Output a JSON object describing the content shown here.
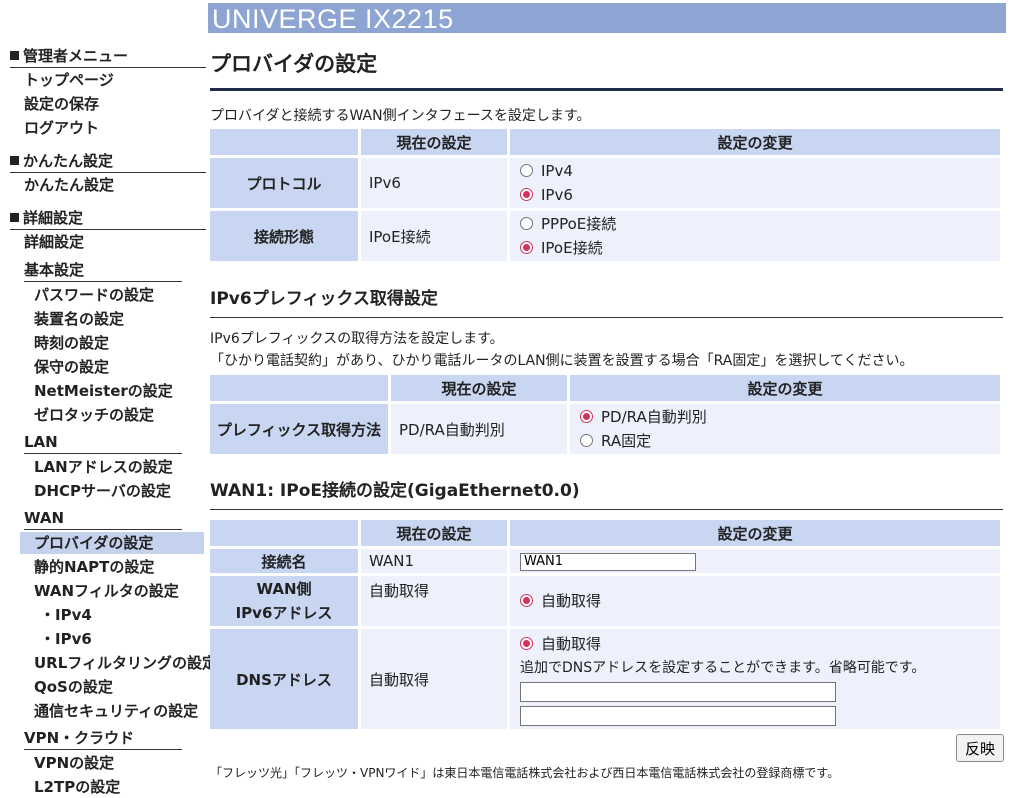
{
  "header": {
    "title": "UNIVERGE IX2215"
  },
  "sidebar": {
    "admin_menu": "管理者メニュー",
    "top_page": "トップページ",
    "save_settings": "設定の保存",
    "logout": "ログアウト",
    "easy_setup": "かんたん設定",
    "easy_setup_item": "かんたん設定",
    "detail_setup": "詳細設定",
    "detail_setup_item": "詳細設定",
    "basic": "基本設定",
    "password": "パスワードの設定",
    "device_name": "装置名の設定",
    "time": "時刻の設定",
    "maintenance": "保守の設定",
    "netmeister": "NetMeisterの設定",
    "zero_touch": "ゼロタッチの設定",
    "lan": "LAN",
    "lan_address": "LANアドレスの設定",
    "dhcp": "DHCPサーバの設定",
    "wan": "WAN",
    "provider": "プロバイダの設定",
    "static_napt": "静的NAPTの設定",
    "wan_filter": "WANフィルタの設定",
    "ipv4": "・IPv4",
    "ipv6": "・IPv6",
    "url_filter": "URLフィルタリングの設定",
    "qos": "QoSの設定",
    "security": "通信セキュリティの設定",
    "vpn_cloud": "VPN・クラウド",
    "vpn": "VPNの設定",
    "l2tp": "L2TPの設定"
  },
  "main": {
    "title": "プロバイダの設定",
    "provider_desc": "プロバイダと接続するWAN側インタフェースを設定します。",
    "col_current": "現在の設定",
    "col_change": "設定の変更",
    "protocol_label": "プロトコル",
    "protocol_current": "IPv6",
    "protocol_options": [
      "IPv4",
      "IPv6"
    ],
    "protocol_selected": "IPv6",
    "conn_type_label": "接続形態",
    "conn_type_current": "IPoE接続",
    "conn_type_options": [
      "PPPoE接続",
      "IPoE接続"
    ],
    "conn_type_selected": "IPoE接続",
    "prefix_section": "IPv6プレフィックス取得設定",
    "prefix_desc1": "IPv6プレフィックスの取得方法を設定します。",
    "prefix_desc2": "「ひかり電話契約」があり、ひかり電話ルータのLAN側に装置を設置する場合「RA固定」を選択してください。",
    "prefix_label": "プレフィックス取得方法",
    "prefix_current": "PD/RA自動判別",
    "prefix_options": [
      "PD/RA自動判別",
      "RA固定"
    ],
    "prefix_selected": "PD/RA自動判別",
    "wan1_section": "WAN1: IPoE接続の設定(GigaEthernet0.0)",
    "conn_name_label": "接続名",
    "conn_name_current": "WAN1",
    "conn_name_value": "WAN1",
    "wan_ipv6_label_1": "WAN側",
    "wan_ipv6_label_2": "IPv6アドレス",
    "wan_ipv6_current": "自動取得",
    "wan_ipv6_option": "自動取得",
    "dns_label": "DNSアドレス",
    "dns_current": "自動取得",
    "dns_option": "自動取得",
    "dns_note": "追加でDNSアドレスを設定することができます。省略可能です。",
    "dns1_value": "",
    "dns2_value": "",
    "apply_button": "反映",
    "footer": "「フレッツ光」「フレッツ・VPNワイド」は東日本電信電話株式会社および西日本電信電話株式会社の登録商標です。"
  },
  "colors": {
    "header_bg": "#8ea5d4",
    "table_header": "#c8d6f2",
    "table_cell": "#eef0fb",
    "radio_checked": "#d2335c"
  }
}
